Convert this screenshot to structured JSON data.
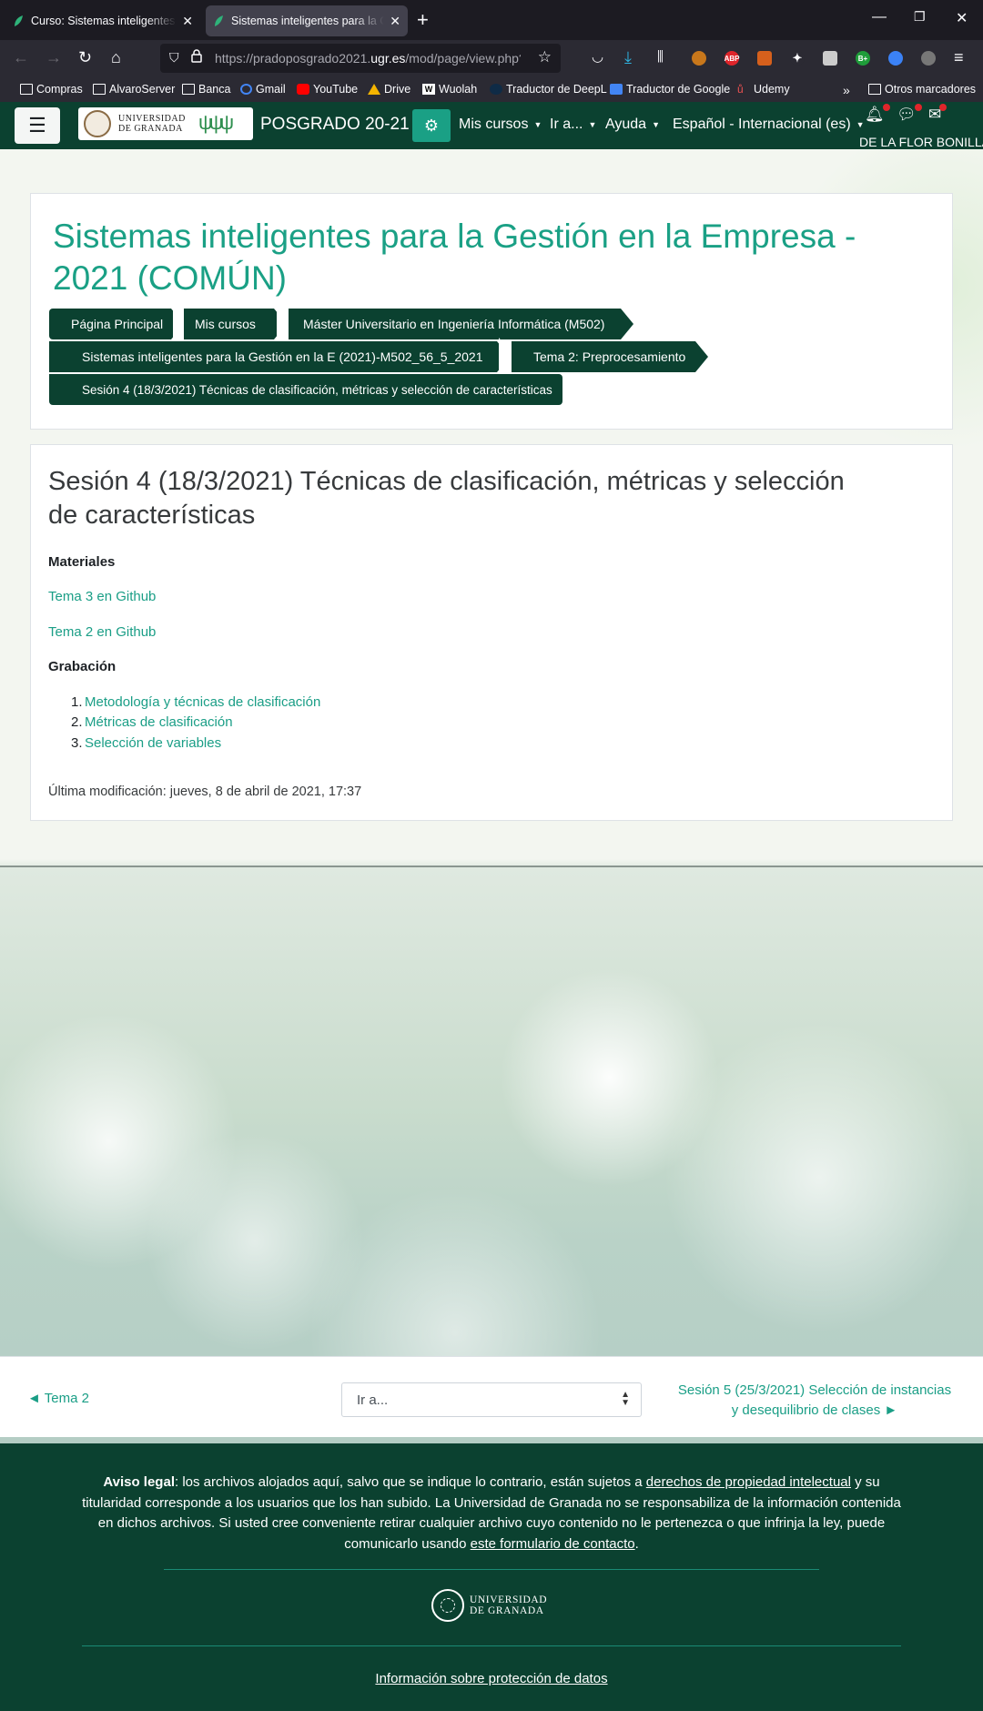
{
  "browser": {
    "tabs": [
      {
        "label": "Curso: Sistemas inteligentes para la",
        "active": false
      },
      {
        "label": "Sistemas inteligentes para la Gestión",
        "active": true
      }
    ],
    "url_prefix": "https://pradoposgrado2021.",
    "url_domain": "ugr.es",
    "url_suffix": "/mod/page/view.php?id",
    "bookmarks": [
      "Compras",
      "AlvaroServer",
      "Banca",
      "Gmail",
      "YouTube",
      "Drive",
      "Wuolah",
      "Traductor de DeepL",
      "Traductor de Google",
      "Udemy"
    ],
    "other_bookmarks": "Otros marcadores",
    "ext_abp": "ABP",
    "ext_b": "B+"
  },
  "header": {
    "logo_line1": "UNIVERSIDAD",
    "logo_line2": "DE GRANADA",
    "site_name": "POSGRADO 20-21",
    "menu": {
      "my_courses": "Mis cursos",
      "go_to": "Ir a...",
      "help": "Ayuda",
      "language": "Español - Internacional (es)"
    },
    "user_name": "DE LA FLOR BONILLA"
  },
  "course": {
    "title": "Sistemas inteligentes para la Gestión en la Empresa - 2021 (COMÚN)",
    "breadcrumb": [
      "Página Principal",
      "Mis cursos",
      "Máster Universitario en Ingeniería Informática (M502)",
      "Sistemas inteligentes para la Gestión en la E (2021)-M502_56_5_2021",
      "Tema 2: Preprocesamiento",
      "Sesión 4 (18/3/2021) Técnicas de clasificación, métricas y selección de características"
    ]
  },
  "page": {
    "heading": "Sesión 4 (18/3/2021) Técnicas de clasificación, métricas y selección de características",
    "materials_label": "Materiales",
    "materials": [
      "Tema 3 en Github",
      "Tema 2 en Github"
    ],
    "recording_label": "Grabación",
    "recordings": [
      "Metodología y técnicas de clasificación",
      "Métricas de clasificación",
      "Selección de variables"
    ],
    "last_modified": "Última modificación: jueves, 8 de abril de 2021, 17:37"
  },
  "activity_nav": {
    "prev": "◄ Tema 2",
    "jump_placeholder": "Ir a...",
    "next": "Sesión 5 (25/3/2021) Selección de instancias y desequilibrio de clases ►"
  },
  "footer": {
    "legal_bold": "Aviso legal",
    "legal_1": ": los archivos alojados aquí, salvo que se indique lo contrario, están sujetos a ",
    "legal_link1": "derechos de propiedad intelectual",
    "legal_2": " y su titularidad corresponde a los usuarios que los han subido. La Universidad de Granada no se responsabiliza de la información contenida en dichos archivos. Si usted cree conveniente retirar cualquier archivo cuyo contenido no le pertenezca o que infrinja la ley, puede comunicarlo usando ",
    "legal_link2": "este formulario de contacto",
    "legal_3": ".",
    "logo_line1": "UNIVERSIDAD",
    "logo_line2": "DE GRANADA",
    "privacy": "Información sobre protección de datos"
  },
  "colors": {
    "brand_dark": "#0b4130",
    "accent": "#1aa085",
    "link": "#1a9e86"
  }
}
